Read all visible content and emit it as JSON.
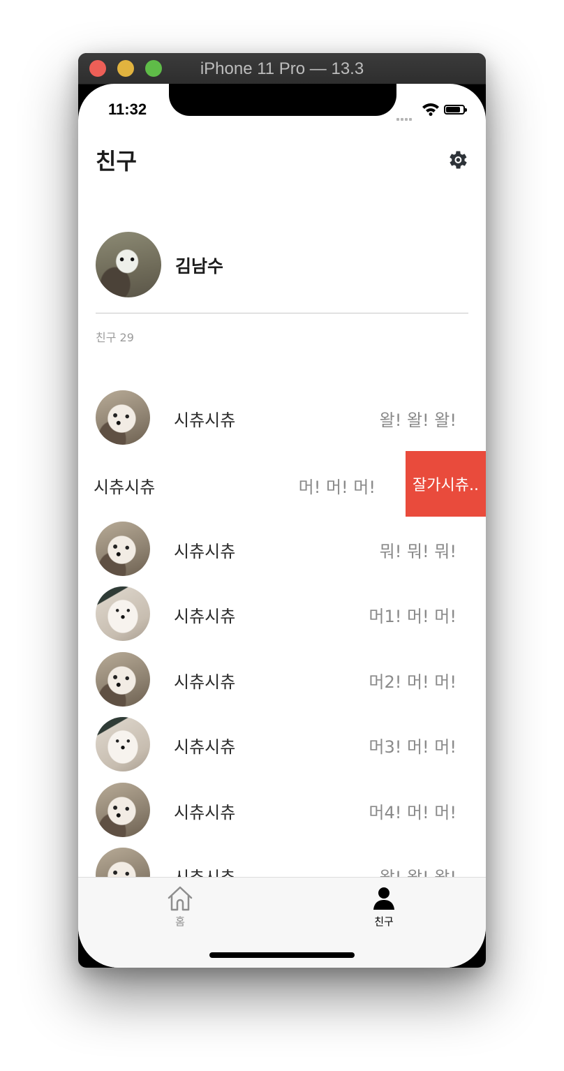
{
  "window": {
    "title": "iPhone 11 Pro — 13.3"
  },
  "status_bar": {
    "time": "11:32"
  },
  "header": {
    "title": "친구",
    "settings_icon": "gear-icon"
  },
  "profile": {
    "name": "김남수"
  },
  "friends_section": {
    "count_label": "친구 29"
  },
  "friends": [
    {
      "name": "시츄시츄",
      "status": "왈! 왈! 왈!",
      "avatar": "av-a"
    },
    {
      "name": "시츄시츄",
      "status": "머! 머! 머!",
      "swiped": true
    },
    {
      "name": "시츄시츄",
      "status": "뭐! 뭐! 뭐!",
      "avatar": "av-a"
    },
    {
      "name": "시츄시츄",
      "status": "머1! 머! 머!",
      "avatar": "av-b"
    },
    {
      "name": "시츄시츄",
      "status": "머2! 머! 머!",
      "avatar": "av-a"
    },
    {
      "name": "시츄시츄",
      "status": "머3! 머! 머!",
      "avatar": "av-b"
    },
    {
      "name": "시츄시츄",
      "status": "머4! 머! 머!",
      "avatar": "av-a"
    },
    {
      "name": "시츄시츄",
      "status": "왈! 왈! 왈!",
      "avatar": "av-a"
    }
  ],
  "swipe_action": {
    "label": "잘가시츄..",
    "color": "#e94b3c"
  },
  "tabbar": {
    "items": [
      {
        "label": "홈",
        "icon": "home-icon",
        "active": false
      },
      {
        "label": "친구",
        "icon": "person-icon",
        "active": true
      }
    ]
  }
}
